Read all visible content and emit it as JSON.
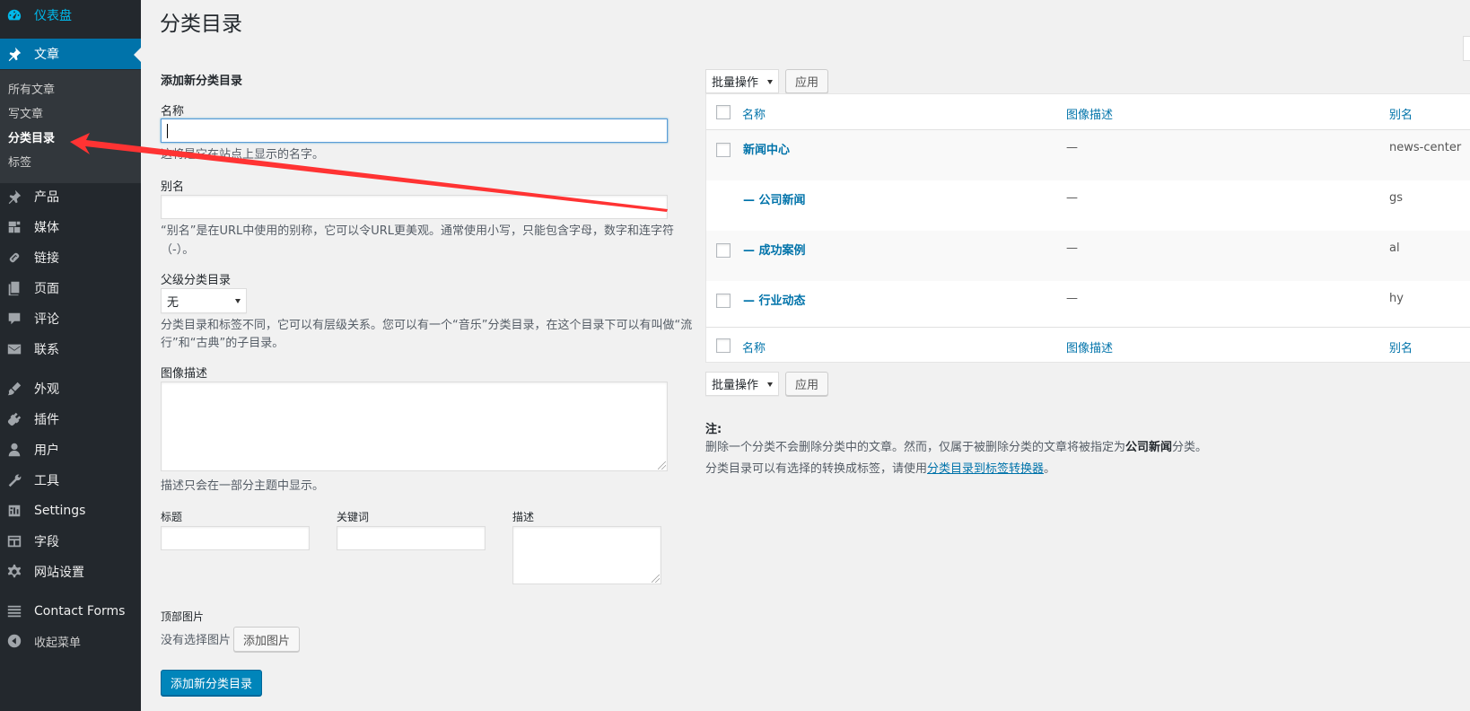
{
  "sidebar": {
    "dashboard": "仪表盘",
    "posts": "文章",
    "submenu": [
      "所有文章",
      "写文章",
      "分类目录",
      "标签"
    ],
    "products": "产品",
    "media": "媒体",
    "links": "链接",
    "pages": "页面",
    "comments": "评论",
    "contact": "联系",
    "appearance": "外观",
    "plugins": "插件",
    "users": "用户",
    "tools": "工具",
    "settings": "Settings",
    "fields": "字段",
    "site_settings": "网站设置",
    "contact_forms": "Contact Forms",
    "collapse": "收起菜单"
  },
  "page": {
    "title": "分类目录"
  },
  "form": {
    "heading": "添加新分类目录",
    "name_label": "名称",
    "name_value": "",
    "name_desc": "这将是它在站点上显示的名字。",
    "slug_label": "别名",
    "slug_value": "",
    "slug_desc_1": "“别名”是在URL中使用的别称，它可以令URL更美观。通常使用小写，只能包含字母，数字和连字符",
    "slug_desc_2": "（-）。",
    "parent_label": "父级分类目录",
    "parent_selected": "无",
    "parent_desc_1": "分类目录和标签不同，它可以有层级关系。您可以有一个“音乐”分类目录，在这个目录下可以有叫做“流",
    "parent_desc_2": "行”和“古典”的子目录。",
    "image_desc_label": "图像描述",
    "image_desc_help": "描述只会在一部分主题中显示。",
    "seo_title_label": "标题",
    "seo_keywords_label": "关键词",
    "seo_desc_label": "描述",
    "banner_label": "顶部图片",
    "no_image": "没有选择图片",
    "add_image": "添加图片",
    "submit": "添加新分类目录"
  },
  "table": {
    "bulk_actions": "批量操作",
    "apply": "应用",
    "col_name": "名称",
    "col_image_desc": "图像描述",
    "col_slug": "别名",
    "rows": [
      {
        "name": "新闻中心",
        "desc": "—",
        "slug": "news-center"
      },
      {
        "name": "— 公司新闻",
        "desc": "—",
        "slug": "gs"
      },
      {
        "name": "— 成功案例",
        "desc": "—",
        "slug": "al"
      },
      {
        "name": "— 行业动态",
        "desc": "—",
        "slug": "hy"
      }
    ]
  },
  "notes": {
    "title": "注:",
    "line1_pre": "删除一个分类不会删除分类中的文章。然而，仅属于被删除分类的文章将被指定为",
    "line1_bold": "公司新闻",
    "line1_post": "分类。",
    "line2_pre": "分类目录可以有选择的转换成标签，请使用",
    "line2_link": "分类目录到标签转换器",
    "line2_post": "。"
  },
  "colors": {
    "accent": "#0073aa",
    "sidebar_bg": "#23282d",
    "annotation_arrow": "#ff3333"
  }
}
